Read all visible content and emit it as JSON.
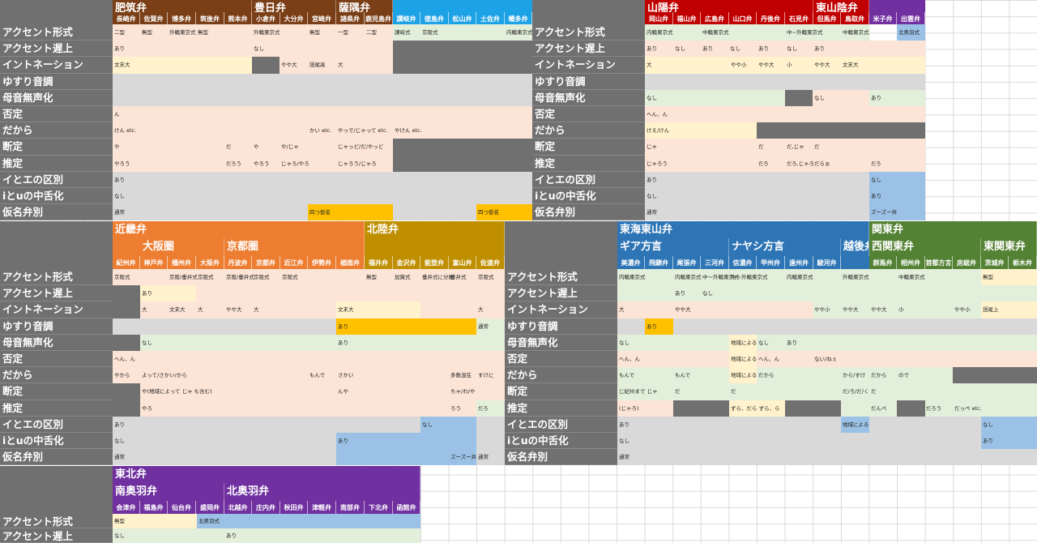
{
  "colors": {
    "label": "#707070",
    "hizen": "#7b3f17",
    "shikoku": "#1ea2e6",
    "sanyo": "#c00000",
    "sanin": "#7030a0",
    "kinki": "#ed7d31",
    "hokuriku": "#bf8f00",
    "tokai": "#2e75b6",
    "kanto": "#548235",
    "tohoku": "#7030a0",
    "pink": "#fce4d6",
    "green": "#e2efda",
    "yellow": "#fff2cc",
    "grey": "#d9d9d9",
    "dark": "#707070",
    "gold": "#ffc000",
    "blue": "#9bc2e6"
  },
  "row_labels": [
    "アクセント形式",
    "アクセント遅上",
    "イントネーション",
    "ゆすり音調",
    "母音無声化",
    "否定",
    "だから",
    "断定",
    "推定",
    "イとエの区別",
    "iとuの中舌化",
    "仮名弁別"
  ],
  "sections": {
    "kyushu": {
      "groups": [
        "肥筑弁",
        "豊日弁",
        "薩隅弁"
      ],
      "dialects": [
        "長崎弁",
        "佐賀弁",
        "博多弁",
        "筑後弁",
        "熊本弁",
        "小倉弁",
        "大分弁",
        "宮崎弁",
        "諸県弁",
        "鹿児島弁",
        "讃岐弁",
        "徳島弁",
        "松山弁",
        "土佐弁",
        "幡多弁"
      ],
      "cells": {
        "acc": [
          "二型",
          "無型",
          "外輪東京式",
          "無型",
          "外輪東京式",
          "無型",
          "一型",
          "二型",
          "讃岐式",
          "京阪式",
          "内輪東京式"
        ],
        "late": [
          "あり",
          "なし"
        ],
        "inton": [
          "文末大",
          "やや大",
          "語尾高",
          "大"
        ],
        "neg": [
          "ん"
        ],
        "dakara": [
          "けん etc.",
          "かい etc.",
          "やっで/じゃって etc.",
          "やけん etc."
        ],
        "dantei": [
          "や",
          "だ",
          "や",
          "や/じゃ",
          "じゃっど/だ/やっど"
        ],
        "suitei": [
          "やろう",
          "だろう",
          "やろう",
          "じゃろ/やろ",
          "じゃろう/じゃろ"
        ],
        "ie": [
          "あり"
        ],
        "iu": [
          "なし"
        ],
        "kana": [
          "通常",
          "四つ仮名",
          "四つ仮名"
        ]
      }
    },
    "chugoku": {
      "groups": [
        "山陽弁",
        "東山陰弁"
      ],
      "dialects": [
        "岡山弁",
        "福山弁",
        "広島弁",
        "山口弁",
        "丹後弁",
        "石見弁",
        "但馬弁",
        "鳥取弁",
        "米子弁",
        "出雲弁"
      ],
      "cells": {
        "acc": [
          "内輪東京式",
          "中輪東京式",
          "中~外輪東京式",
          "中輪東京式",
          "北奥羽式"
        ],
        "late": [
          "あり",
          "なし",
          "あり",
          "なし",
          "あり",
          "なし",
          "あり"
        ],
        "inton": [
          "大",
          "やや小",
          "やや大",
          "小",
          "やや大",
          "文末大"
        ],
        "devoice": [
          "なし",
          "なし",
          "あり"
        ],
        "neg": [
          "へん、ん"
        ],
        "dakara": [
          "けえ/けん"
        ],
        "dantei": [
          "じゃ",
          "だ",
          "だ,じゃ",
          "だ"
        ],
        "suitei": [
          "じゃろう",
          "だろ",
          "だろ,じゃろ",
          "だらぁ",
          "だろ"
        ],
        "ie": [
          "あり",
          "なし"
        ],
        "iu": [
          "なし",
          "あり"
        ],
        "kana": [
          "通常",
          "ズーズー弁"
        ]
      }
    },
    "kinki": {
      "groups": [
        "近畿弁",
        "大阪圏",
        "京都圏",
        "北陸弁"
      ],
      "dialects": [
        "紀州弁",
        "神戸弁",
        "播州弁",
        "大阪弁",
        "丹波弁",
        "京都弁",
        "近江弁",
        "伊勢弁",
        "楢南弁",
        "福井弁",
        "金沢弁",
        "能登弁",
        "富山弁",
        "佐渡弁"
      ],
      "cells": {
        "acc": [
          "京阪式",
          "京阪/垂井式",
          "京阪式",
          "京阪/垂井式",
          "京阪式",
          "京阪式",
          "無型",
          "加賀式",
          "垂井式に分類",
          "垂井式",
          "京阪式"
        ],
        "late": [
          "あり"
        ],
        "inton": [
          "大",
          "文末大",
          "大",
          "やや大",
          "大",
          "文末大",
          "大"
        ],
        "yusuri": [
          "あり",
          "通常"
        ],
        "devoice": [
          "なし",
          "あり"
        ],
        "neg": [
          "へん、ん"
        ],
        "dakara": [
          "やから",
          "よって/さかい/から",
          "もんで",
          "さかい",
          "多数混在",
          "すけに"
        ],
        "dantei": [
          "や(地域によって じゃ も含む)",
          "んや",
          "ちゃ/わ/や"
        ],
        "suitei": [
          "やろ",
          "ろう",
          "だろ"
        ],
        "ie": [
          "あり",
          "なし"
        ],
        "iu": [
          "なし",
          "あり"
        ],
        "kana": [
          "通常",
          "ズーズー弁",
          "通常"
        ]
      }
    },
    "tokai": {
      "groups": [
        "東海東山弁",
        "ギア方言",
        "ナヤシ方言",
        "越後弁",
        "関東弁",
        "西関東弁",
        "東関東弁"
      ],
      "dialects": [
        "美濃弁",
        "飛騨弁",
        "尾張弁",
        "三河弁",
        "信濃弁",
        "甲州弁",
        "遠州弁",
        "駿河弁",
        "群馬弁",
        "相州弁",
        "首都方言",
        "房総弁",
        "茨城弁",
        "栃木弁"
      ],
      "cells": {
        "acc": [
          "内輪東京式",
          "内輪東京式",
          "中～外輪東京式",
          "中～外輪東京式",
          "内輪東京式",
          "外輪東京式",
          "中輪東京式",
          "無型"
        ],
        "late": [
          "あり",
          "なし"
        ],
        "inton": [
          "大",
          "やや大",
          "やや小",
          "やや大",
          "やや大",
          "小",
          "やや小",
          "語尾上"
        ],
        "yusuri": [
          "あり"
        ],
        "devoice": [
          "なし",
          "地域による",
          "なし",
          "あり"
        ],
        "neg": [
          "へん、ん",
          "地域による",
          "へん、ん",
          "ない/ねぇ"
        ],
        "dakara": [
          "もんで",
          "もんで",
          "地域による",
          "だから",
          "から/すけ",
          "だから",
          "ので"
        ],
        "dantei": [
          "じ紀州まで じゃ",
          "だ",
          "だ",
          "だ/ろ/だ/く",
          "だ"
        ],
        "suitei": [
          "(じゃろ)",
          "ずら、だら ずら、ら",
          "だんべ",
          "だろう",
          "だっぺ etc."
        ],
        "ie": [
          "あり",
          "地域による",
          "なし"
        ],
        "iu": [
          "なし",
          "あり"
        ],
        "kana": [
          "通常"
        ]
      }
    },
    "tohoku": {
      "groups": [
        "東北弁",
        "南奥羽弁",
        "北奥羽弁"
      ],
      "dialects": [
        "会津弁",
        "福島弁",
        "仙台弁",
        "盛岡弁",
        "北越弁",
        "庄内弁",
        "秋田弁",
        "津軽弁",
        "南部弁",
        "下北弁",
        "函館弁"
      ],
      "cells": {
        "acc": [
          "無型",
          "北奥羽式"
        ],
        "late": [
          "なし",
          "あり"
        ]
      }
    }
  }
}
